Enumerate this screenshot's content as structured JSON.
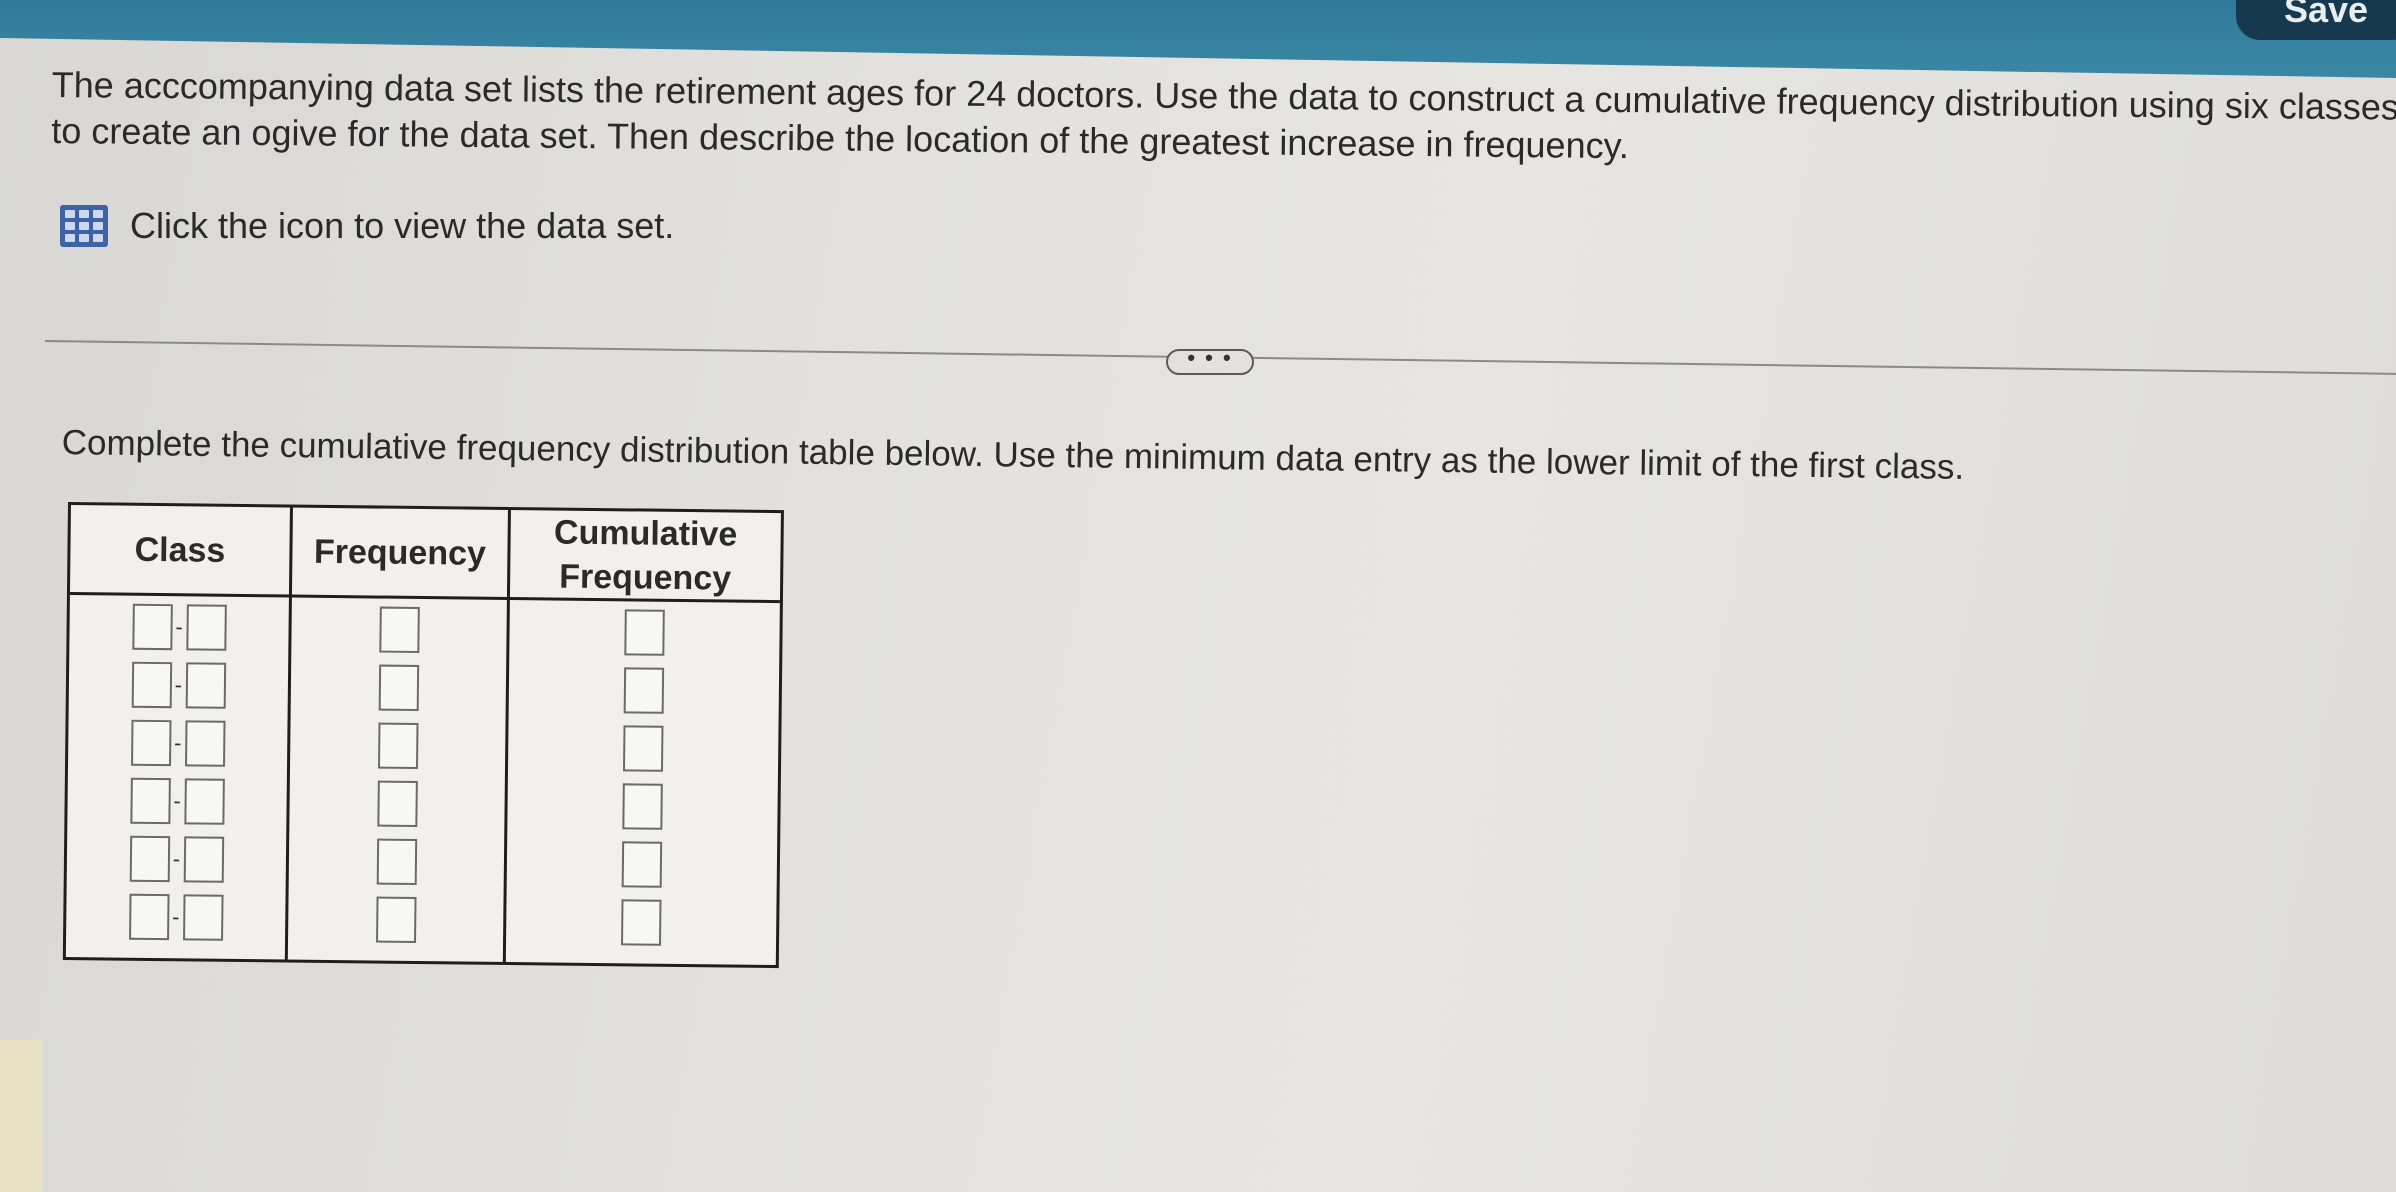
{
  "toolbar": {
    "save_label": "Save"
  },
  "question": {
    "line1": "The acccompanying data set lists the retirement ages for 24 doctors. Use the data to construct a cumulative frequency distribution using six classes an",
    "line2": "to create an ogive for the data set. Then describe the location of the greatest increase in frequency."
  },
  "dataset_link": {
    "icon": "data-table-icon",
    "label": "Click the icon to view the data set."
  },
  "more_button": {
    "label": "• • •"
  },
  "instruction": "Complete the cumulative frequency distribution table below. Use the minimum data entry as the lower limit of the first class.",
  "table": {
    "headers": {
      "class": "Class",
      "frequency": "Frequency",
      "cumulative_line1": "Cumulative",
      "cumulative_line2": "Frequency"
    },
    "rows": [
      {
        "class_lower": "",
        "class_upper": "",
        "frequency": "",
        "cumulative": ""
      },
      {
        "class_lower": "",
        "class_upper": "",
        "frequency": "",
        "cumulative": ""
      },
      {
        "class_lower": "",
        "class_upper": "",
        "frequency": "",
        "cumulative": ""
      },
      {
        "class_lower": "",
        "class_upper": "",
        "frequency": "",
        "cumulative": ""
      },
      {
        "class_lower": "",
        "class_upper": "",
        "frequency": "",
        "cumulative": ""
      },
      {
        "class_lower": "",
        "class_upper": "",
        "frequency": "",
        "cumulative": ""
      }
    ],
    "class_separator": "-"
  }
}
